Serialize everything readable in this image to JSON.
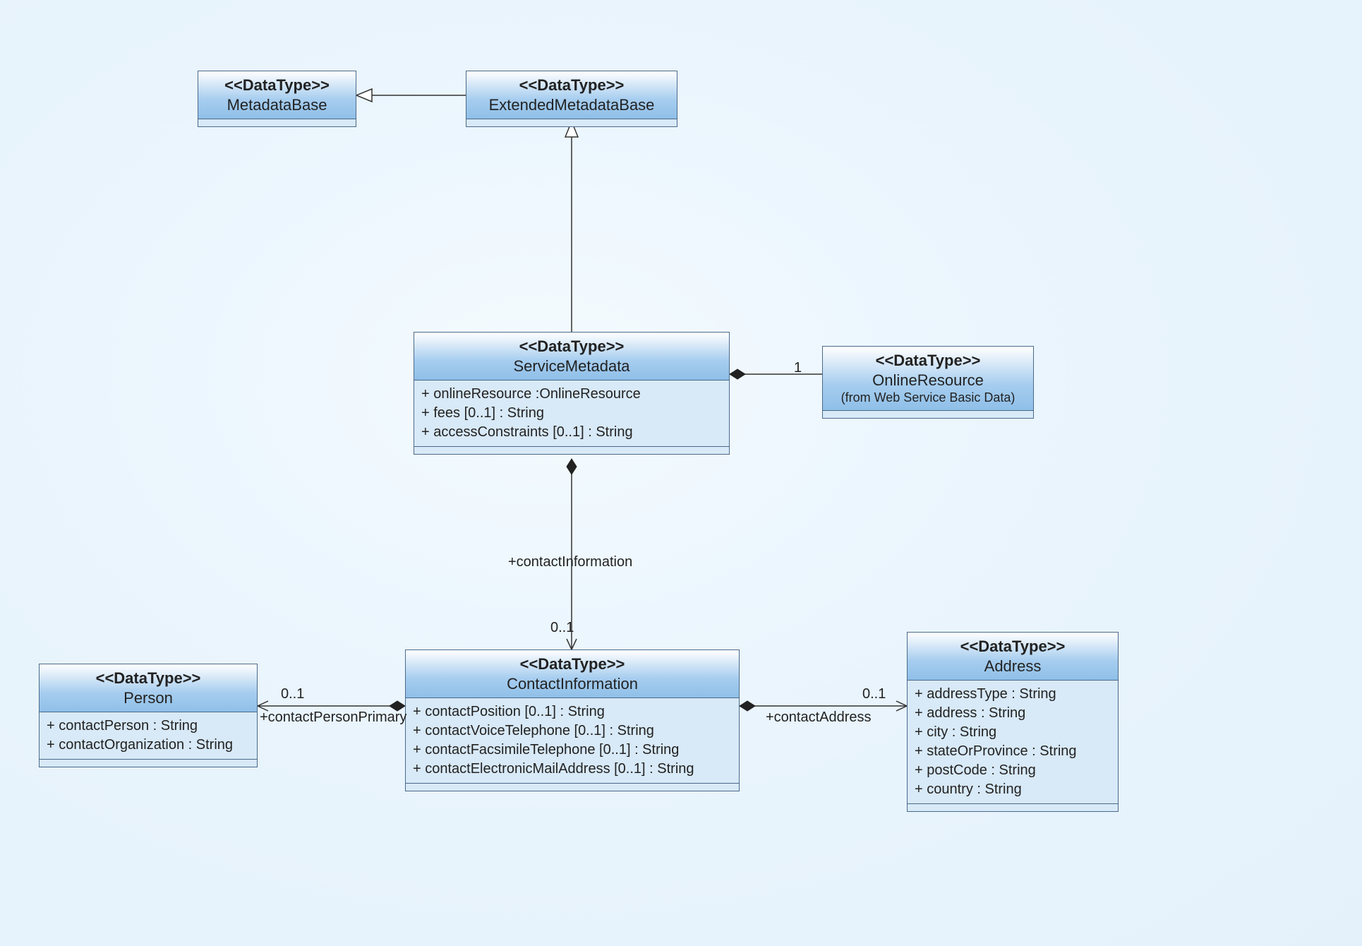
{
  "stereotype": "<<DataType>>",
  "classes": {
    "metadataBase": {
      "name": "MetadataBase"
    },
    "extendedMetadataBase": {
      "name": "ExtendedMetadataBase"
    },
    "serviceMetadata": {
      "name": "ServiceMetadata",
      "attrs": [
        "+ onlineResource :OnlineResource",
        "+ fees [0..1] : String",
        "+ accessConstraints [0..1] : String"
      ]
    },
    "onlineResource": {
      "name": "OnlineResource",
      "note": "(from Web Service Basic Data)"
    },
    "contactInformation": {
      "name": "ContactInformation",
      "attrs": [
        "+ contactPosition [0..1] : String",
        "+ contactVoiceTelephone [0..1] : String",
        "+ contactFacsimileTelephone [0..1] : String",
        "+ contactElectronicMailAddress [0..1] : String"
      ]
    },
    "person": {
      "name": "Person",
      "attrs": [
        "+ contactPerson : String",
        "+ contactOrganization : String"
      ]
    },
    "address": {
      "name": "Address",
      "attrs": [
        "+ addressType : String",
        "+ address : String",
        "+ city : String",
        "+ stateOrProvince : String",
        "+ postCode : String",
        "+ country : String"
      ]
    }
  },
  "edgeLabels": {
    "onlineResourceMult": "1",
    "contactInfoRole": "+contactInformation",
    "contactInfoMult": "0..1",
    "personMult": "0..1",
    "personRole": "+contactPersonPrimary",
    "addressMult": "0..1",
    "addressRole": "+contactAddress"
  }
}
